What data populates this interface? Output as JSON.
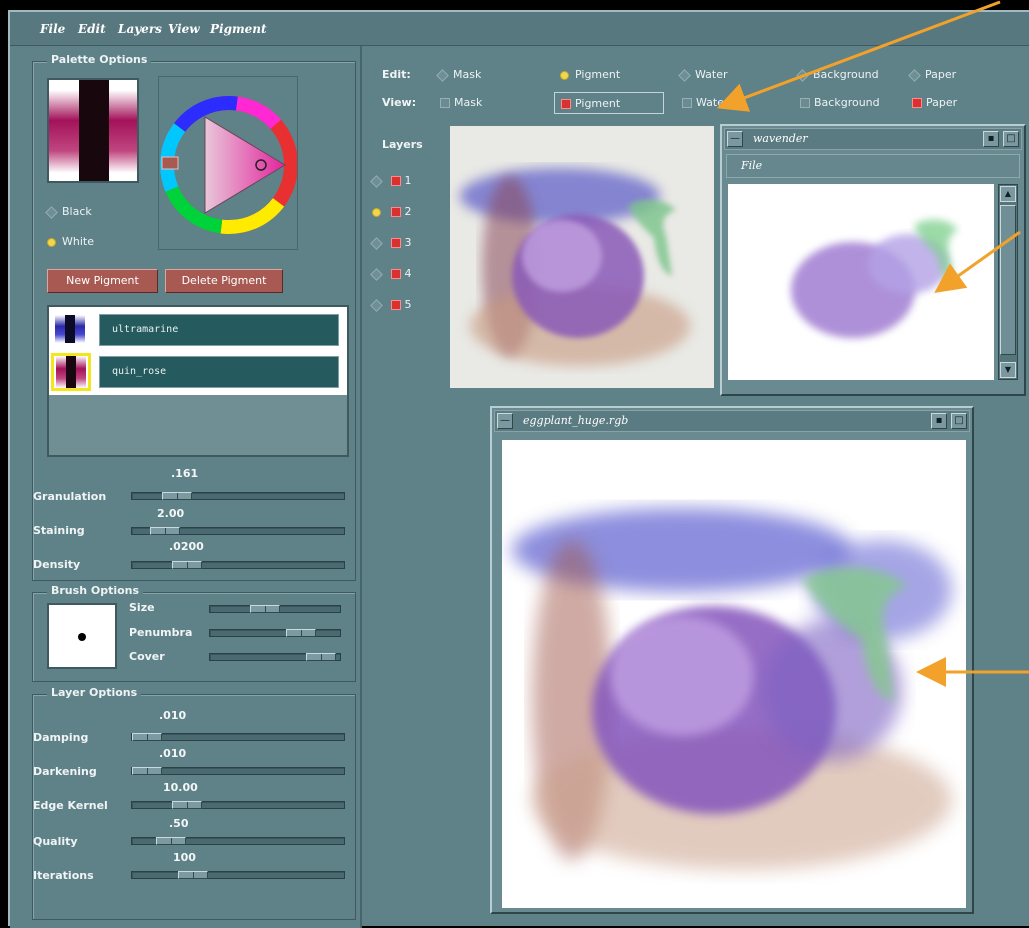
{
  "menu": [
    "File",
    "Edit",
    "Layers",
    "View",
    "Pigment"
  ],
  "palette": {
    "title": "Palette Options",
    "background_options": [
      {
        "label": "Black",
        "selected": false
      },
      {
        "label": "White",
        "selected": true
      }
    ],
    "new_pigment_label": "New Pigment",
    "delete_pigment_label": "Delete Pigment",
    "pigments": [
      {
        "name": "ultramarine",
        "selected": false,
        "color": "#2a2aa8"
      },
      {
        "name": "quin_rose",
        "selected": true,
        "color": "#a3125a"
      }
    ],
    "sliders": [
      {
        "label": "Granulation",
        "value": ".161",
        "fraction": 0.2
      },
      {
        "label": "Staining",
        "value": "2.00",
        "fraction": 0.15
      },
      {
        "label": "Density",
        "value": ".0200",
        "fraction": 0.25
      }
    ]
  },
  "brush": {
    "title": "Brush Options",
    "sliders": [
      {
        "label": "Size",
        "fraction": 0.4
      },
      {
        "label": "Penumbra",
        "fraction": 0.6
      },
      {
        "label": "Cover",
        "fraction": 0.95
      }
    ]
  },
  "layer_options": {
    "title": "Layer Options",
    "sliders": [
      {
        "label": "Damping",
        "value": ".010",
        "fraction": 0.1
      },
      {
        "label": "Darkening",
        "value": ".010",
        "fraction": 0.1
      },
      {
        "label": "Edge Kernel",
        "value": "10.00",
        "fraction": 0.3
      },
      {
        "label": "Quality",
        "value": ".50",
        "fraction": 0.2
      },
      {
        "label": "Iterations",
        "value": "100",
        "fraction": 0.3
      }
    ]
  },
  "edit_row": {
    "label": "Edit:",
    "options": [
      {
        "label": "Mask",
        "selected": false
      },
      {
        "label": "Pigment",
        "selected": true
      },
      {
        "label": "Water",
        "selected": false
      },
      {
        "label": "Background",
        "selected": false
      },
      {
        "label": "Paper",
        "selected": false
      }
    ]
  },
  "view_row": {
    "label": "View:",
    "options": [
      {
        "label": "Mask",
        "checked": false
      },
      {
        "label": "Pigment",
        "checked": true
      },
      {
        "label": "Water",
        "checked": false
      },
      {
        "label": "Background",
        "checked": false
      },
      {
        "label": "Paper",
        "checked": true
      }
    ]
  },
  "layers": {
    "title": "Layers",
    "items": [
      {
        "label": "1",
        "active": false,
        "visible": true
      },
      {
        "label": "2",
        "active": true,
        "visible": true
      },
      {
        "label": "3",
        "active": false,
        "visible": true
      },
      {
        "label": "4",
        "active": false,
        "visible": true
      },
      {
        "label": "5",
        "active": false,
        "visible": true
      }
    ]
  },
  "windows": {
    "small": {
      "title": "wavender",
      "menu_label": "File"
    },
    "large": {
      "title": "eggplant_huge.rgb"
    }
  },
  "colors": {
    "panel": "#5f8188",
    "button": "#a85a52",
    "accent_arrow": "#f2a22a",
    "selection": "#f3e61d"
  }
}
